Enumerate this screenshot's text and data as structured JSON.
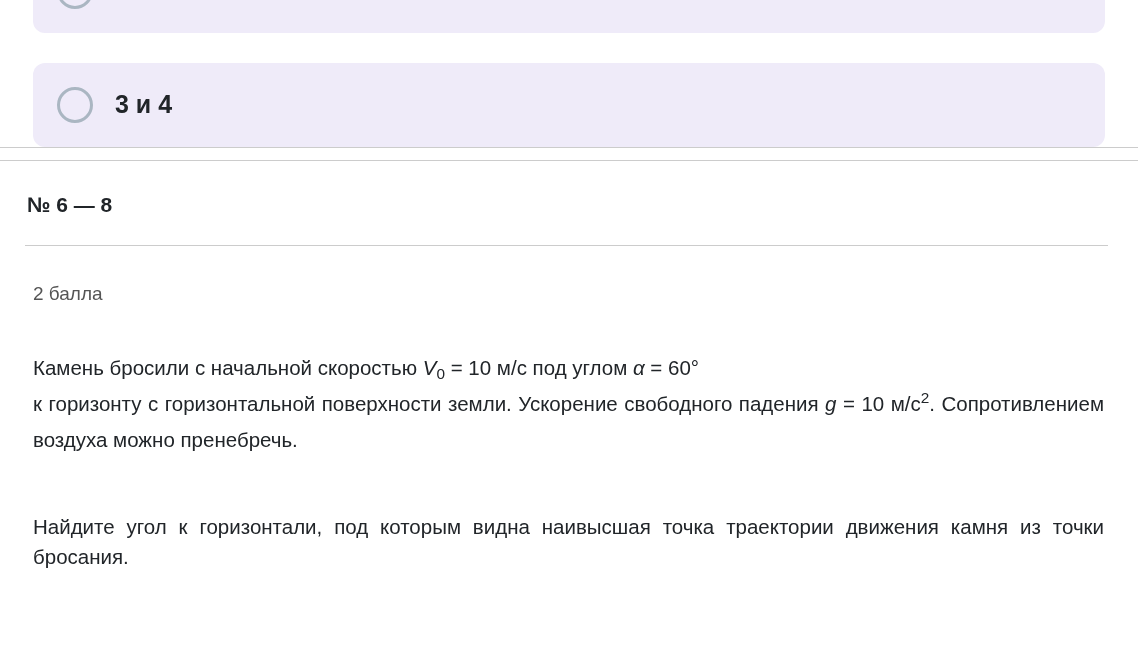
{
  "options": [
    {
      "selected": false
    },
    {
      "label": "3 и 4",
      "selected": false
    }
  ],
  "question": {
    "number": "№ 6 — 8",
    "points": "2 балла",
    "paragraphs": [
      "Камень бросили с начальной скоростью *V*$_{0}$ = 10 м/с под углом *α* = 60°\nк горизонту с горизонтальной поверхности земли. Ускорение свободного падения *g* = 10 м/с$^{2}$. Сопротивлением воздуха можно пренебречь.",
      "Найдите угол к горизонтали, под которым видна наивысшая точка траектории движения камня из точки бросания."
    ]
  }
}
